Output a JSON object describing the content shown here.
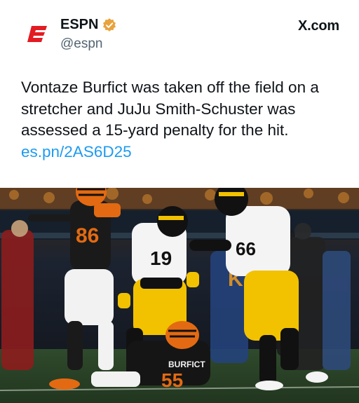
{
  "author": {
    "display_name": "ESPN",
    "handle": "@espn",
    "verified": true,
    "logo_icon": "espn-logo-icon",
    "brand_color": "#e31b23"
  },
  "source_label": "X.com",
  "tweet": {
    "text": "Vontaze Burfict was taken off the field on a stretcher and JuJu Smith-Schuster was assessed a 15-yard penalty for the hit.",
    "link": "es.pn/2AS6D25"
  },
  "photo": {
    "jerseys": {
      "bengal_left": "86",
      "steeler_center": "19",
      "steeler_right": "66",
      "burfict_name": "BURFICT",
      "burfict_number": "55"
    }
  },
  "colors": {
    "text_primary": "#0f1419",
    "text_secondary": "#536471",
    "link": "#1d9bf0",
    "verified_badge": "#e8a33d"
  }
}
